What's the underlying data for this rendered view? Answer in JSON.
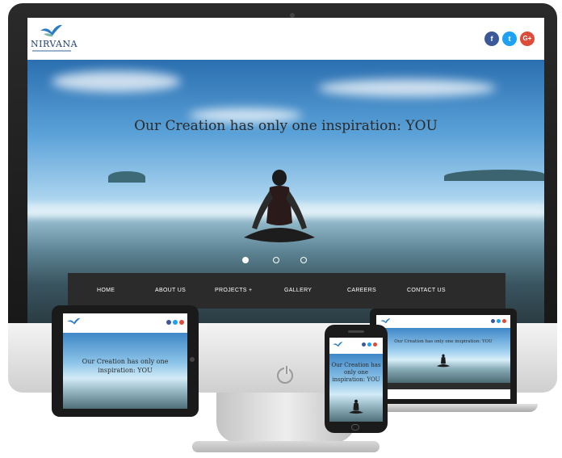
{
  "brand": {
    "name": "NIRVANA"
  },
  "hero": {
    "headline": "Our Creation has only one inspiration: YOU",
    "slides": 3,
    "active_slide": 1
  },
  "nav": {
    "items": [
      {
        "label": "HOME"
      },
      {
        "label": "ABOUT US"
      },
      {
        "label": "PROJECTS +"
      },
      {
        "label": "GALLERY"
      },
      {
        "label": "CAREERS"
      },
      {
        "label": "CONTACT US"
      }
    ]
  },
  "social": {
    "facebook": "f",
    "twitter": "t",
    "googleplus": "G+"
  },
  "tablet": {
    "headline": "Our Creation has only one inspiration: YOU"
  },
  "laptop": {
    "headline": "Our Creation has only one inspiration: YOU"
  },
  "phone": {
    "headline": "Our Creation has only one inspiration: YOU"
  },
  "colors": {
    "nav_bg": "#2b2b2b",
    "facebook": "#3b5998",
    "twitter": "#1da1f2",
    "googleplus": "#dd4b39",
    "brand_blue": "#1f3f6e"
  },
  "icons": {
    "power": "power-icon",
    "logo": "bird-logo-icon"
  }
}
